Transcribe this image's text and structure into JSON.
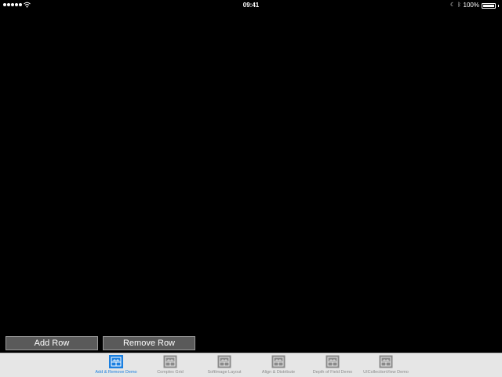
{
  "status_bar": {
    "time": "09:41",
    "battery": "100%",
    "battery_level": 1.0,
    "signal_dots": 5
  },
  "buttons": {
    "add_row": "Add Row",
    "remove_row": "Remove Row"
  },
  "tab_bar": {
    "active_index": 0,
    "active_color": "#1a7fe0",
    "inactive_color": "#8a8a8a",
    "tabs": [
      {
        "label": "Add & Remove Demo",
        "icon": "grid-layout-icon"
      },
      {
        "label": "Complex Grid",
        "icon": "grid-layout-icon"
      },
      {
        "label": "SoftImage Layout",
        "icon": "grid-layout-icon"
      },
      {
        "label": "Align & Distribute",
        "icon": "grid-layout-icon"
      },
      {
        "label": "Depth of Field Demo",
        "icon": "grid-layout-icon"
      },
      {
        "label": "UICollectionView Demo",
        "icon": "grid-layout-icon"
      }
    ]
  }
}
